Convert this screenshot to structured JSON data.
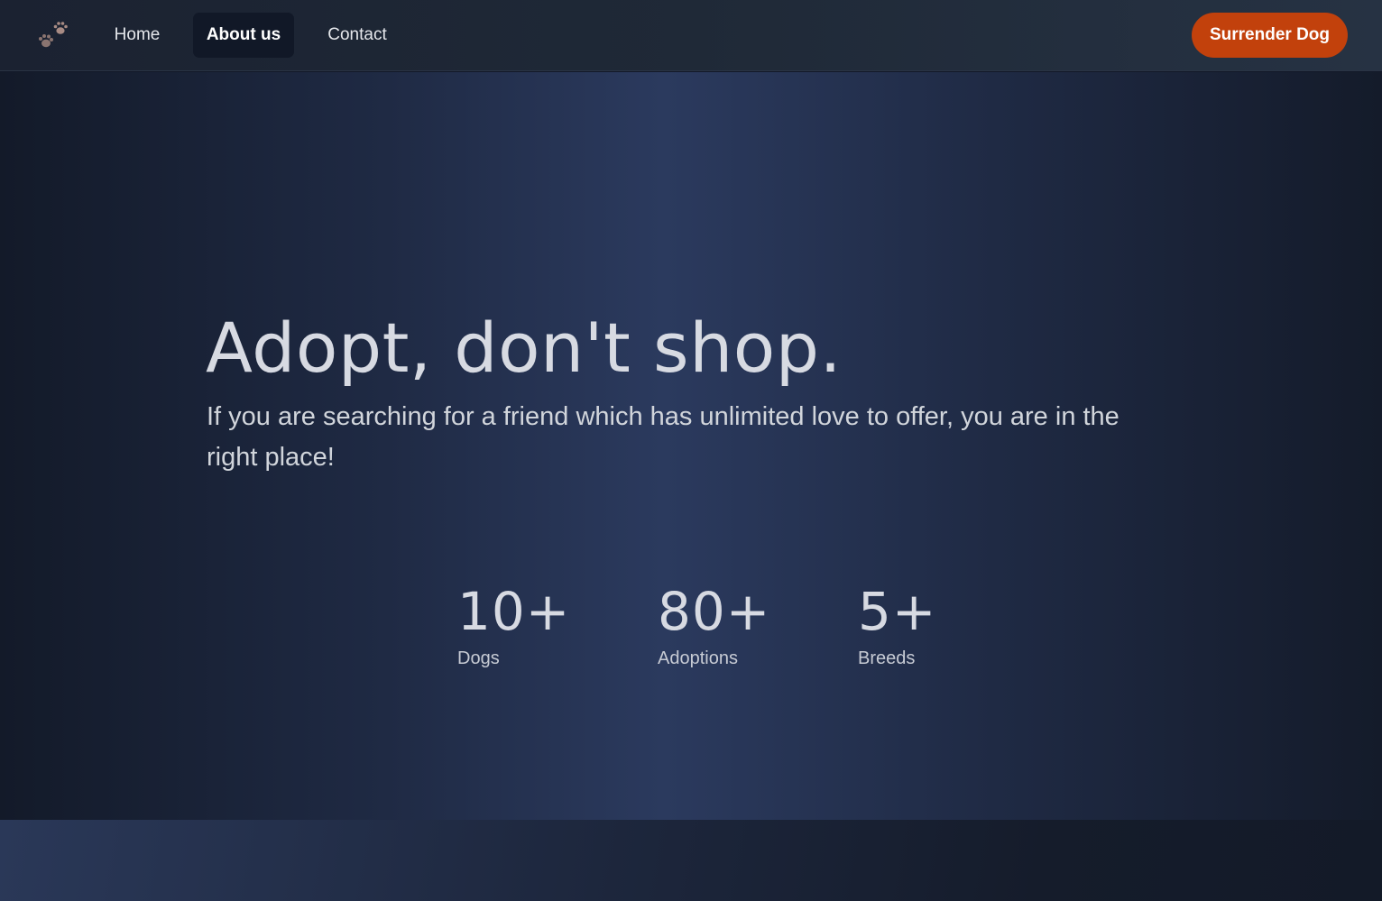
{
  "nav": {
    "logo_icon": "paw-prints-icon",
    "items": [
      {
        "label": "Home"
      },
      {
        "label": "About us"
      },
      {
        "label": "Contact"
      }
    ],
    "active_index": 1,
    "cta_label": "Surrender Dog"
  },
  "hero": {
    "title": "Adopt, don't shop.",
    "subtitle": "If you are searching for a friend which has unlimited love to offer, you are in the right place!"
  },
  "stats": [
    {
      "value": "10+",
      "label": "Dogs"
    },
    {
      "value": "80+",
      "label": "Adoptions"
    },
    {
      "value": "5+",
      "label": "Breeds"
    }
  ],
  "colors": {
    "accent": "#c2410c",
    "nav_bg": "#1f2937",
    "active_nav_bg": "#111827",
    "text": "#d7dae2"
  }
}
